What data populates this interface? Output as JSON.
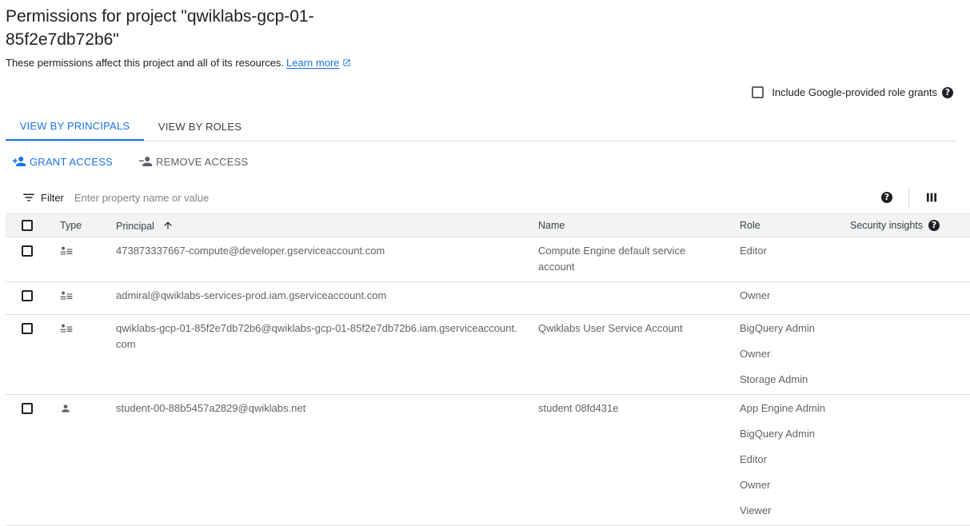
{
  "page": {
    "title": "Permissions for project \"qwiklabs-gcp-01-85f2e7db72b6\"",
    "subtitle": "These permissions affect this project and all of its resources.",
    "learn_more": "Learn more",
    "include_google_grants": "Include Google-provided role grants"
  },
  "tabs": [
    {
      "label": "VIEW BY PRINCIPALS",
      "active": true
    },
    {
      "label": "VIEW BY ROLES",
      "active": false
    }
  ],
  "actions": {
    "grant_access": "GRANT ACCESS",
    "remove_access": "REMOVE ACCESS"
  },
  "filter": {
    "label": "Filter",
    "placeholder": "Enter property name or value"
  },
  "table": {
    "headers": {
      "type": "Type",
      "principal": "Principal",
      "name": "Name",
      "role": "Role",
      "security_insights": "Security insights"
    },
    "rows": [
      {
        "type_icon": "service-account-icon",
        "principal": "473873337667-compute@developer.gserviceaccount.com",
        "name": "Compute Engine default service account",
        "roles": [
          "Editor"
        ]
      },
      {
        "type_icon": "service-account-icon",
        "principal": "admiral@qwiklabs-services-prod.iam.gserviceaccount.com",
        "name": "",
        "roles": [
          "Owner"
        ]
      },
      {
        "type_icon": "service-account-icon",
        "principal": "qwiklabs-gcp-01-85f2e7db72b6@qwiklabs-gcp-01-85f2e7db72b6.iam.gserviceaccount.com",
        "name": "Qwiklabs User Service Account",
        "roles": [
          "BigQuery Admin",
          "Owner",
          "Storage Admin"
        ]
      },
      {
        "type_icon": "person-icon",
        "principal": "student-00-88b5457a2829@qwiklabs.net",
        "name": "student 08fd431e",
        "roles": [
          "App Engine Admin",
          "BigQuery Admin",
          "Editor",
          "Owner",
          "Viewer"
        ]
      }
    ]
  },
  "colors": {
    "accent": "#1a73e8",
    "text": "#202124",
    "muted": "#5f6368",
    "header_bg": "#f1f3f4",
    "divider": "#dadce0"
  }
}
